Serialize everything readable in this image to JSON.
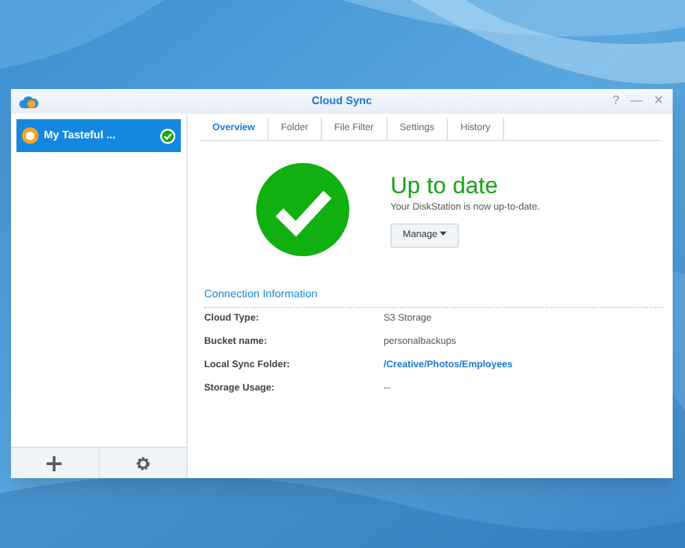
{
  "window": {
    "title": "Cloud Sync",
    "controls": [
      "?",
      "—",
      "✕"
    ]
  },
  "sidebar": {
    "items": [
      {
        "label": "My Tasteful ...",
        "selected": true,
        "synced": true
      }
    ]
  },
  "tabs": [
    {
      "label": "Overview",
      "selected": true
    },
    {
      "label": "Folder",
      "selected": false
    },
    {
      "label": "File Filter",
      "selected": false
    },
    {
      "label": "Settings",
      "selected": false
    },
    {
      "label": "History",
      "selected": false
    }
  ],
  "status": {
    "kind": "ok",
    "title": "Up to date",
    "message": "Your DiskStation is now up-to-date.",
    "button": "Manage"
  },
  "connection": {
    "heading": "Connection Information",
    "rows": [
      {
        "label": "Cloud Type:",
        "value": "S3 Storage",
        "kind": "text"
      },
      {
        "label": "Bucket name:",
        "value": "personalbackups",
        "kind": "text"
      },
      {
        "label": "Local Sync Folder:",
        "value": "/Creative/Photos/Employees",
        "kind": "link"
      },
      {
        "label": "Storage Usage:",
        "value": "--",
        "kind": "text"
      }
    ]
  }
}
